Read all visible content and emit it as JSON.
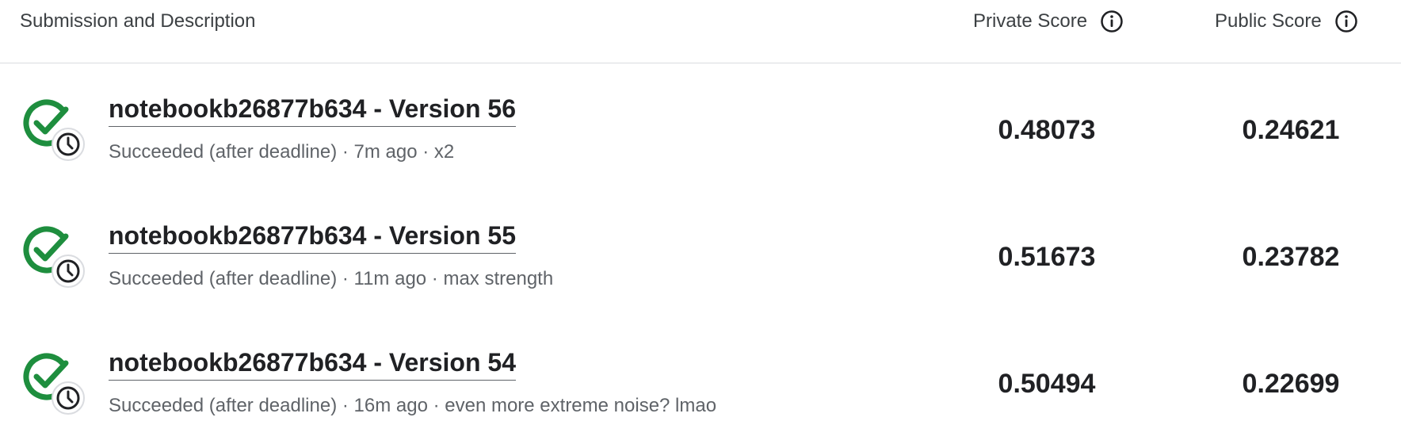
{
  "header": {
    "title": "Submission and Description",
    "private_score_label": "Private Score",
    "public_score_label": "Public Score"
  },
  "icons": {
    "info": "info-circle-icon",
    "status": "check-with-clock-icon"
  },
  "colors": {
    "success_green": "#1e8e3e",
    "text_primary": "#202124",
    "text_secondary": "#5f6368"
  },
  "submissions": [
    {
      "title": "notebookb26877b634 - Version 56",
      "description": "Succeeded (after deadline) · 7m ago · x2",
      "private_score": "0.48073",
      "public_score": "0.24621"
    },
    {
      "title": "notebookb26877b634 - Version 55",
      "description": "Succeeded (after deadline) · 11m ago · max strength",
      "private_score": "0.51673",
      "public_score": "0.23782"
    },
    {
      "title": "notebookb26877b634 - Version 54",
      "description": "Succeeded (after deadline) · 16m ago · even more extreme noise? lmao",
      "private_score": "0.50494",
      "public_score": "0.22699"
    }
  ]
}
